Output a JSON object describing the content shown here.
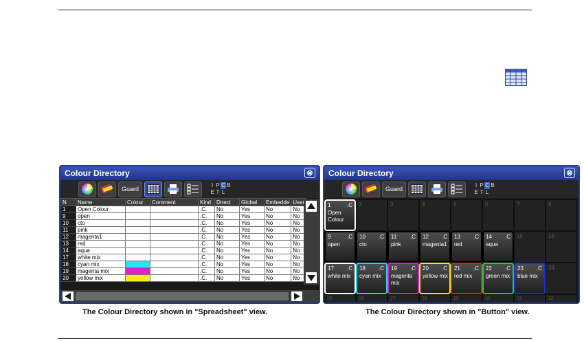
{
  "captions": {
    "spreadsheet": "The Colour Directory shown in \"Spreadsheet\" view.",
    "button": "The Colour Directory shown in \"Button\" view."
  },
  "window": {
    "title": "Colour Directory",
    "close_label": "⊗",
    "guard_label": "Guard",
    "filter_letters": [
      "I",
      "P",
      "C",
      "B",
      "E",
      "T",
      "L",
      ""
    ],
    "filter_active": "C"
  },
  "spreadsheet": {
    "columns": [
      "N",
      "Name",
      "Colour",
      "Comment",
      "Kind",
      "Direct",
      "Global",
      "Embedde",
      "User"
    ],
    "rows": [
      {
        "n": "1",
        "name": "Open Colour",
        "colour": "#ffffff",
        "kind": ".C.",
        "direct": "No",
        "global": "Yes",
        "embedded": "No",
        "user": "No"
      },
      {
        "n": "9",
        "name": "open",
        "colour": "#ffffff",
        "kind": ".C.",
        "direct": "No",
        "global": "Yes",
        "embedded": "No",
        "user": "No"
      },
      {
        "n": "10",
        "name": "cto",
        "colour": "#ffffff",
        "kind": ".C.",
        "direct": "No",
        "global": "Yes",
        "embedded": "No",
        "user": "No"
      },
      {
        "n": "11",
        "name": "pink",
        "colour": "#ffffff",
        "kind": ".C.",
        "direct": "No",
        "global": "Yes",
        "embedded": "No",
        "user": "No"
      },
      {
        "n": "12",
        "name": "magenta1",
        "colour": "#ffffff",
        "kind": ".C.",
        "direct": "No",
        "global": "Yes",
        "embedded": "No",
        "user": "No"
      },
      {
        "n": "13",
        "name": "red",
        "colour": "#ffffff",
        "kind": ".C.",
        "direct": "No",
        "global": "Yes",
        "embedded": "No",
        "user": "No"
      },
      {
        "n": "14",
        "name": "aqua",
        "colour": "#ffffff",
        "kind": ".C.",
        "direct": "No",
        "global": "Yes",
        "embedded": "No",
        "user": "No"
      },
      {
        "n": "17",
        "name": "white mix",
        "colour": "#ffffff",
        "kind": ".C.",
        "direct": "No",
        "global": "Yes",
        "embedded": "No",
        "user": "No"
      },
      {
        "n": "18",
        "name": "cyan mix",
        "colour": "#22e8f0",
        "kind": ".C.",
        "direct": "No",
        "global": "Yes",
        "embedded": "No",
        "user": "No"
      },
      {
        "n": "19",
        "name": "magenta mix",
        "colour": "#e020c8",
        "kind": ".C.",
        "direct": "No",
        "global": "Yes",
        "embedded": "No",
        "user": "No"
      },
      {
        "n": "20",
        "name": "yellow mix",
        "colour": "#f5ee10",
        "kind": ".C.",
        "direct": "No",
        "global": "Yes",
        "embedded": "No",
        "user": "No"
      }
    ]
  },
  "buttons": {
    "cells": [
      {
        "n": "1",
        "kind": ".C",
        "name": "Open Colour",
        "filled": true,
        "border": "#ffffff"
      },
      {
        "n": "2"
      },
      {
        "n": "3"
      },
      {
        "n": "4"
      },
      {
        "n": "5"
      },
      {
        "n": "6"
      },
      {
        "n": "7"
      },
      {
        "n": "8"
      },
      {
        "n": "9",
        "kind": ".C",
        "name": "open",
        "filled": true,
        "border": "#000000"
      },
      {
        "n": "10",
        "kind": ".C",
        "name": "cto",
        "filled": true,
        "border": "#000000"
      },
      {
        "n": "11",
        "kind": ".C",
        "name": "pink",
        "filled": true,
        "border": "#000000"
      },
      {
        "n": "12",
        "kind": ".C",
        "name": "magenta1",
        "filled": true,
        "border": "#000000"
      },
      {
        "n": "13",
        "kind": ".C",
        "name": "red",
        "filled": true,
        "border": "#000000"
      },
      {
        "n": "14",
        "kind": ".C",
        "name": "aqua",
        "filled": true,
        "border": "#000000"
      },
      {
        "n": "15"
      },
      {
        "n": "16"
      },
      {
        "n": "17",
        "kind": ".C",
        "name": "white mix",
        "filled": true,
        "border": "#ffffff"
      },
      {
        "n": "18",
        "kind": ".C",
        "name": "cyan mix",
        "filled": true,
        "border": "#22d8e8"
      },
      {
        "n": "19",
        "kind": ".C",
        "name": "magenta mix",
        "filled": true,
        "border": "#e020c8"
      },
      {
        "n": "20",
        "kind": ".C",
        "name": "yellow mix",
        "filled": true,
        "border": "#f0e820"
      },
      {
        "n": "21",
        "kind": ".C",
        "name": "red mix",
        "filled": true,
        "border": "#e02020"
      },
      {
        "n": "22",
        "kind": ".C",
        "name": "green mix",
        "filled": true,
        "border": "#20d040"
      },
      {
        "n": "23",
        "kind": ".C",
        "name": "blue mix",
        "filled": true,
        "border": "#2030d8"
      },
      {
        "n": "24"
      },
      {
        "n": "25"
      },
      {
        "n": "26"
      },
      {
        "n": "27"
      },
      {
        "n": "28"
      },
      {
        "n": "29"
      },
      {
        "n": "30"
      },
      {
        "n": "31"
      },
      {
        "n": "32"
      }
    ]
  },
  "colors": {
    "title_bar": "#2a45a0",
    "window_border": "#273c8e",
    "active_toggle": "#2f68c8"
  }
}
